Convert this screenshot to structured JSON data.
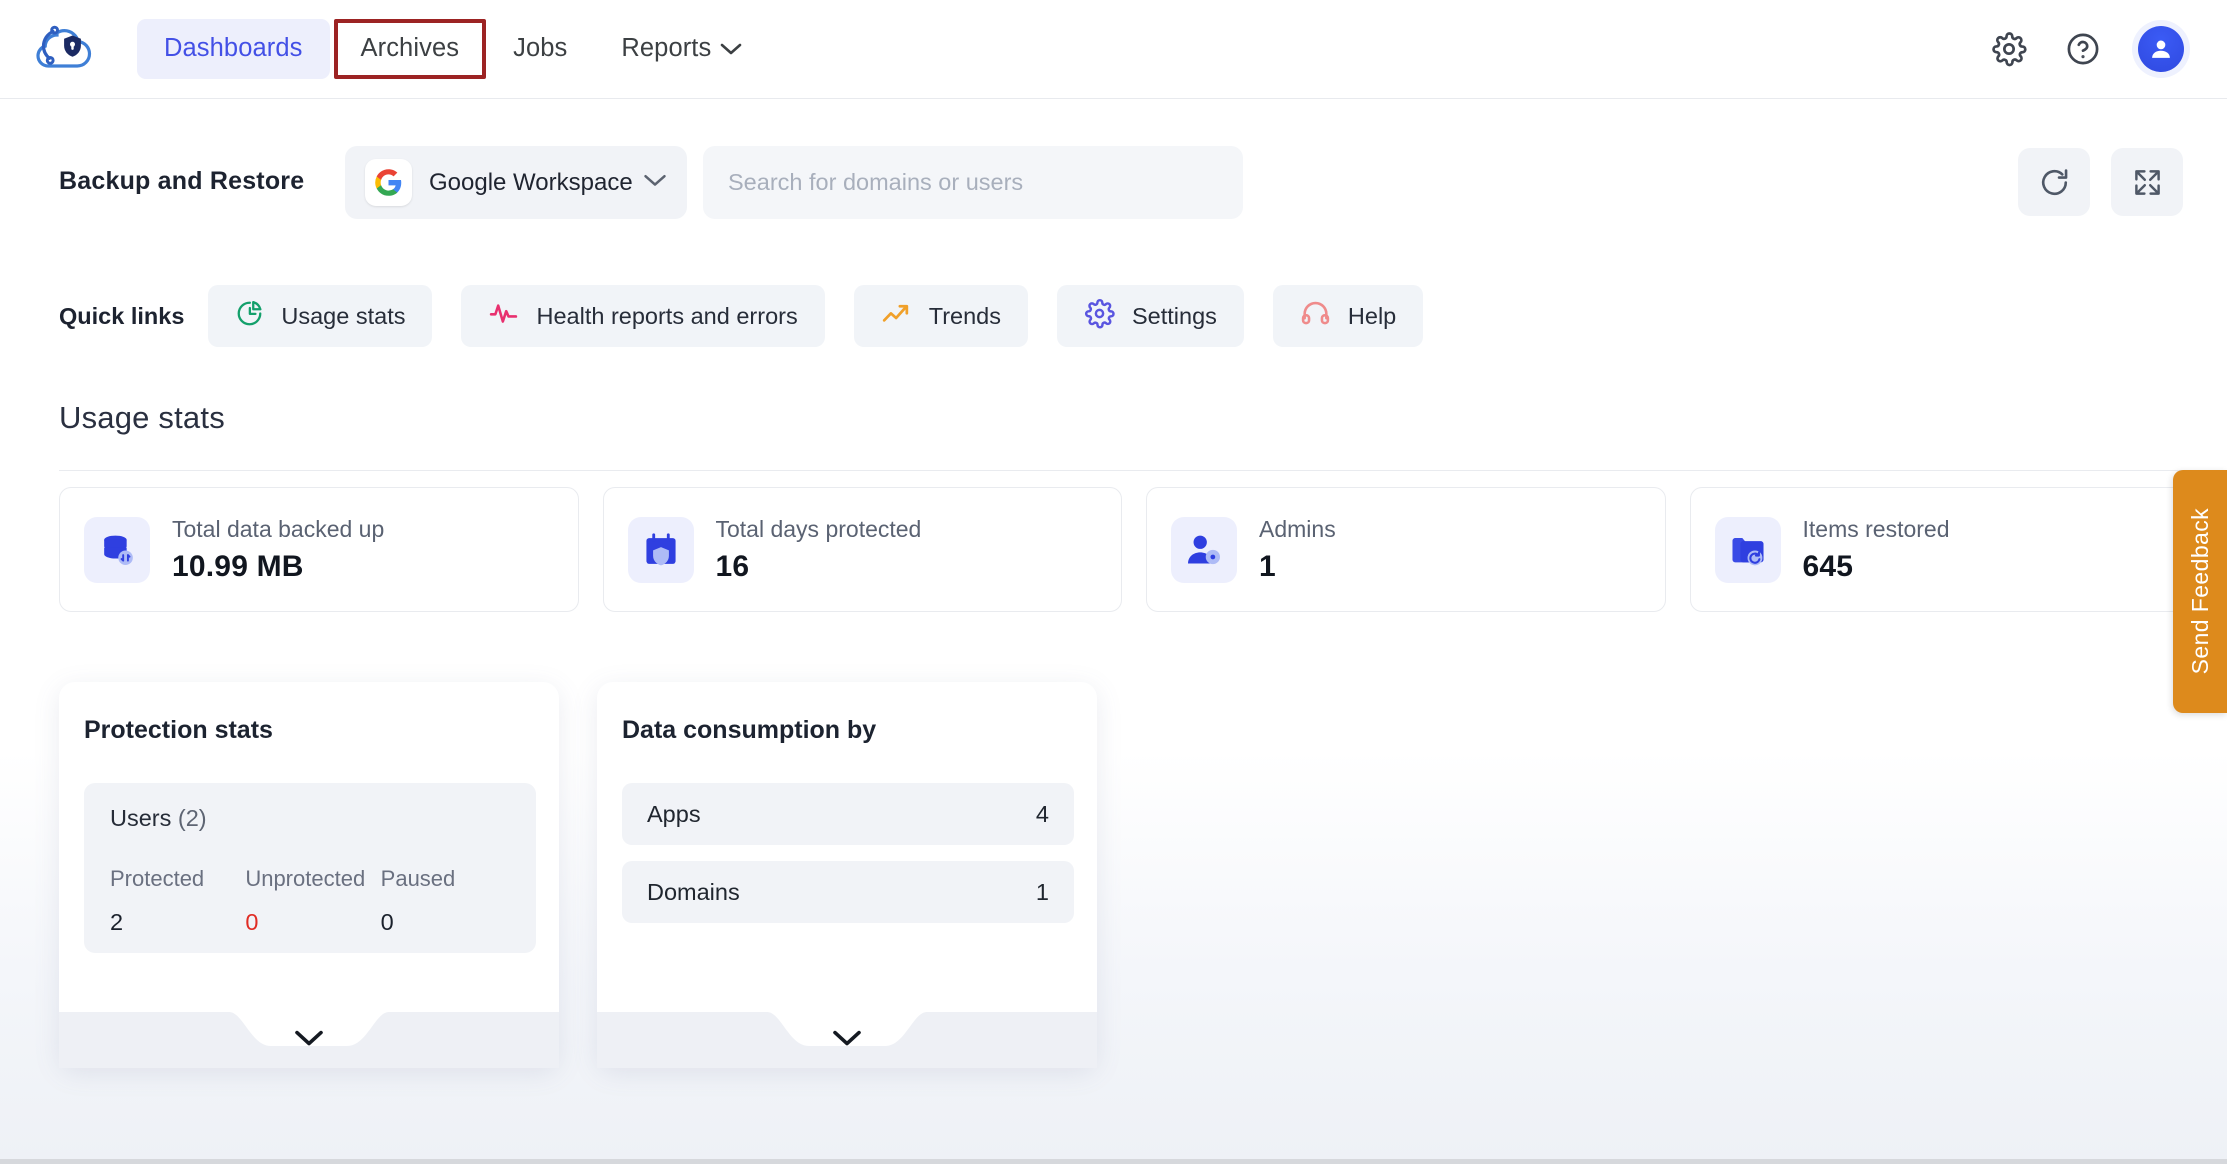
{
  "brand": {
    "logo_icon": "cloud-shield-logo",
    "accent": "#4350e6"
  },
  "nav": {
    "tabs": [
      {
        "label": "Dashboards",
        "state": "active"
      },
      {
        "label": "Archives",
        "state": "highlighted"
      },
      {
        "label": "Jobs",
        "state": "default"
      },
      {
        "label": "Reports",
        "state": "default",
        "caret": "⌄"
      }
    ],
    "right_icons": [
      {
        "name": "gear-icon",
        "label": "Settings"
      },
      {
        "name": "help-circle-icon",
        "label": "Help"
      },
      {
        "name": "user-avatar",
        "label": "Account"
      }
    ],
    "annotation_color": "#9c2323"
  },
  "subheader": {
    "title": "Backup and Restore",
    "workspace_select": {
      "value": "Google Workspace",
      "icon": "google-icon",
      "caret": "⌄"
    },
    "search": {
      "value": "",
      "placeholder": "Search for domains or users"
    },
    "actions": [
      {
        "name": "refresh-button",
        "icon": "refresh-icon"
      },
      {
        "name": "expand-button",
        "icon": "fullscreen-expand-icon"
      }
    ]
  },
  "quick_links": {
    "label": "Quick links",
    "items": [
      {
        "label": "Usage stats",
        "icon": "pie-chart-icon",
        "color": "#13a06b"
      },
      {
        "label": "Health reports and errors",
        "icon": "activity-pulse-icon",
        "color": "#e8306f"
      },
      {
        "label": "Trends",
        "icon": "trending-up-icon",
        "color": "#f0a02a"
      },
      {
        "label": "Settings",
        "icon": "gear-icon",
        "color": "#5a55e0"
      },
      {
        "label": "Help",
        "icon": "headset-icon",
        "color": "#ef8b8b"
      }
    ]
  },
  "usage_stats": {
    "section_title": "Usage stats",
    "cards": [
      {
        "label": "Total data backed up",
        "value": "10.99 MB",
        "icon": "database-sync-icon"
      },
      {
        "label": "Total days protected",
        "value": "16",
        "icon": "calendar-shield-icon"
      },
      {
        "label": "Admins",
        "value": "1",
        "icon": "user-gear-icon"
      },
      {
        "label": "Items restored",
        "value": "645",
        "icon": "folder-restore-icon"
      }
    ]
  },
  "protection_stats": {
    "title": "Protection stats",
    "group_label": "Users",
    "group_count": "(2)",
    "columns": [
      {
        "header": "Protected",
        "value": "2",
        "danger": false
      },
      {
        "header": "Unprotected",
        "value": "0",
        "danger": true
      },
      {
        "header": "Paused",
        "value": "0",
        "danger": false
      }
    ],
    "expand_icon": "chevron-down-icon"
  },
  "data_consumption": {
    "title": "Data consumption by",
    "rows": [
      {
        "name": "Apps",
        "value": "4"
      },
      {
        "name": "Domains",
        "value": "1"
      }
    ],
    "expand_icon": "chevron-down-icon"
  },
  "feedback": {
    "label": "Send Feedback",
    "color": "#dd8a1c"
  }
}
